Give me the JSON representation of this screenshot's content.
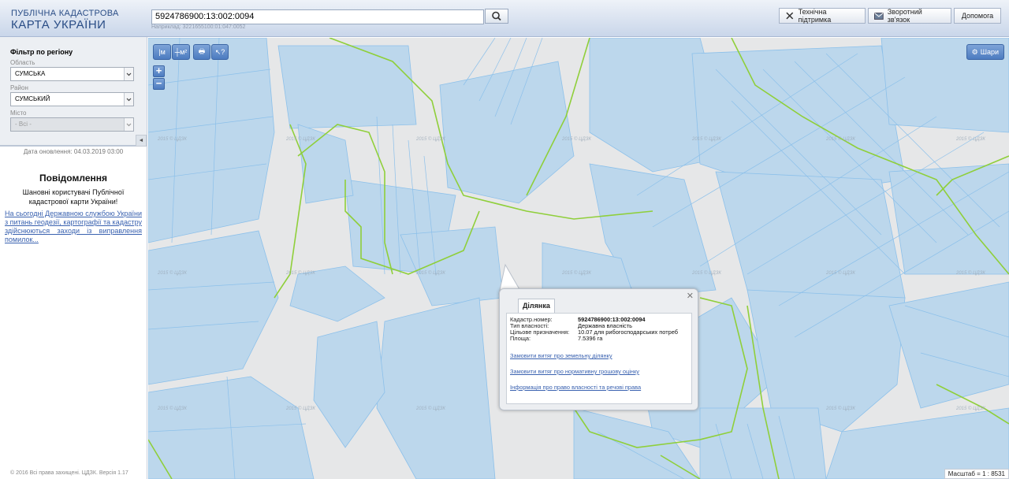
{
  "header": {
    "logo_line1": "ПУБЛІЧНА КАДАСТРОВА",
    "logo_line2": "КАРТА УКРАЇНИ",
    "search_value": "5924786900:13:002:0094",
    "example": "Наприклад: 3221655100:01:047:0052",
    "btn_support": "Технічна підтримка",
    "btn_feedback": "Зворотний зв'язок",
    "btn_help": "Допомога"
  },
  "sidebar": {
    "filter_title": "Фільтр по регіону",
    "oblast_label": "Область",
    "oblast_value": "СУМСЬКА",
    "raion_label": "Район",
    "raion_value": "СУМСЬКИЙ",
    "city_label": "Місто",
    "city_value": "- Всі -",
    "update": "Дата оновлення: 04.03.2019 03:00",
    "notice_title": "Повідомлення",
    "notice_text": "Шановні користувачі Публічної кадастрової карти України!",
    "notice_link": "На сьогодні Державною службою України з питань геодезії, картографії та кадастру здійснюються заходи із виправлення помилок...",
    "copyright": "© 2016 Всі права захищені. ЦДЗК. Версія 1.17"
  },
  "map": {
    "tool1": "|ᴍ",
    "tool2": "┼ᴍ²",
    "tool3": "🖶",
    "tool4": "↖?",
    "zoom_in": "+",
    "zoom_out": "−",
    "layers": "Шари",
    "scale": "Масштаб = 1 : 8531",
    "watermark": "2015 © ЦДЗК"
  },
  "popup": {
    "tab": "Ділянка",
    "rows": [
      {
        "key": "Кадастр.номер:",
        "value": "5924786900:13:002:0094"
      },
      {
        "key": "Тип власності:",
        "value": "Державна власність"
      },
      {
        "key": "Цільове призначення:",
        "value": "10.07 для рибогосподарських потреб"
      },
      {
        "key": "Площа:",
        "value": "7.5396 га"
      }
    ],
    "link1": "Замовити витяг про земельну ділянку",
    "link2": "Замовити витяг про нормативну грошову оцінку",
    "link3": "Інформація про право власності та речові права"
  },
  "colors": {
    "parcel_fill": "#bcd7ec",
    "parcel_stroke": "#7fb6e6",
    "boundary": "#8fcf3a",
    "accent": "#4c7bc0"
  }
}
